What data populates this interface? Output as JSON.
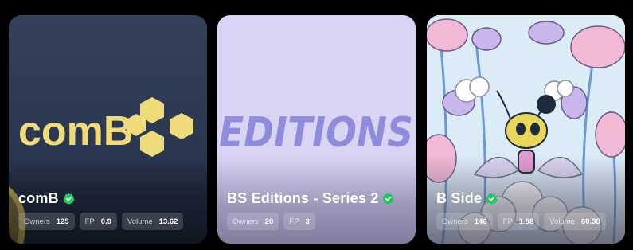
{
  "cards": [
    {
      "title": "comB",
      "verified": true,
      "logo_text": "comB",
      "logo_color": "#f0db7a",
      "stats": [
        {
          "label": "Owners",
          "value": "125"
        },
        {
          "label": "FP",
          "value": "0.9"
        },
        {
          "label": "Volume",
          "value": "13.62"
        }
      ]
    },
    {
      "title": "BS Editions - Series 2",
      "verified": true,
      "logo_text": "EDITIONS",
      "logo_color": "#8f8cdc",
      "stats": [
        {
          "label": "Owners",
          "value": "20"
        },
        {
          "label": "FP",
          "value": "3"
        }
      ]
    },
    {
      "title": "B Side",
      "verified": true,
      "stats": [
        {
          "label": "Owners",
          "value": "146"
        },
        {
          "label": "FP",
          "value": "1.98"
        },
        {
          "label": "Volume",
          "value": "60.98"
        }
      ]
    }
  ],
  "colors": {
    "verified_badge": "#22c55e",
    "background": "#000000"
  }
}
